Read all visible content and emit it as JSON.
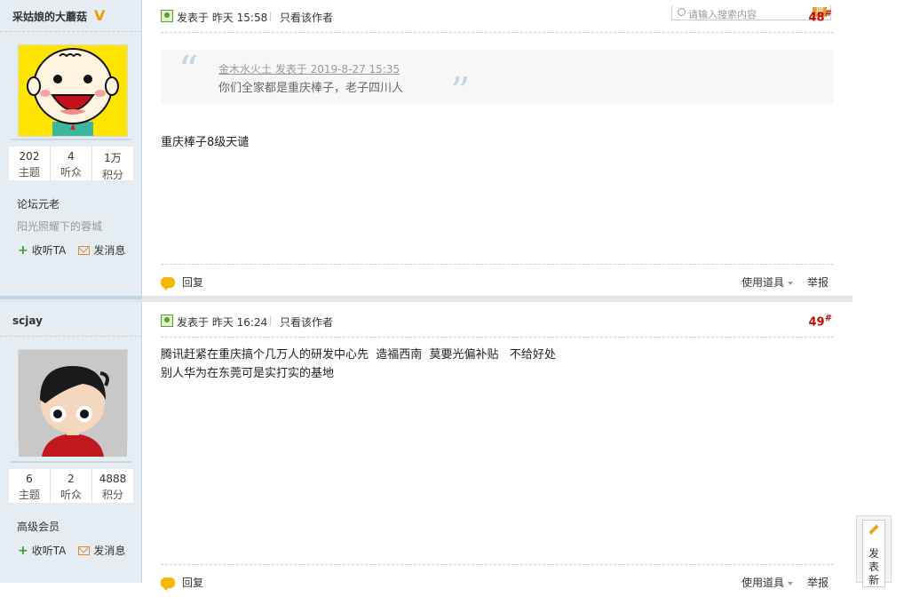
{
  "search": {
    "placeholder": "请输入搜索内容",
    "button": "搜"
  },
  "posts": [
    {
      "username": "采姑娘的大蘑菇",
      "vip_badge": "V",
      "stats": [
        {
          "num": "202",
          "label": "主题"
        },
        {
          "num": "4",
          "label": "听众"
        },
        {
          "num": "1万",
          "label": "积分"
        }
      ],
      "rank": "论坛元老",
      "motto": "阳光照耀下的蓉城",
      "follow": "收听TA",
      "message_btn": "发消息",
      "post_time": "发表于 昨天 15:58",
      "only_author": "只看该作者",
      "floor": "48",
      "floor_mark": "#",
      "quote_author": "金木水火土 发表于 2019-8-27 15:35",
      "quote_text": "你们全家都是重庆棒子，老子四川人",
      "message": "重庆棒子8级天谴",
      "reply": "回复",
      "tools": "使用道具",
      "report": "举报"
    },
    {
      "username": "scjay",
      "stats": [
        {
          "num": "6",
          "label": "主题"
        },
        {
          "num": "2",
          "label": "听众"
        },
        {
          "num": "4888",
          "label": "积分"
        }
      ],
      "rank": "高级会员",
      "follow": "收听TA",
      "message_btn": "发消息",
      "post_time": "发表于 昨天 16:24",
      "only_author": "只看该作者",
      "floor": "49",
      "floor_mark": "#",
      "message_lines": [
        "腾讯赶紧在重庆搞个几万人的研发中心先  造福西南  莫要光偏补贴   不给好处",
        "别人华为在东莞可是实打实的基地"
      ],
      "reply": "回复",
      "tools": "使用道具",
      "report": "举报"
    }
  ],
  "float_button": {
    "label": "发表新"
  },
  "colors": {
    "sidebar_bg": "#e5edf2",
    "floor_red": "#c60a00",
    "accent_orange": "#f39800"
  }
}
